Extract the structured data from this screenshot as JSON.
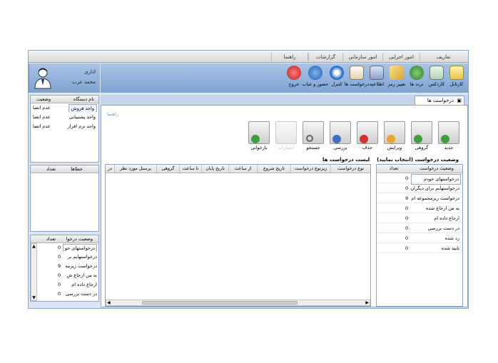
{
  "menu": [
    "تعاریف",
    "امور اجرایی",
    "امور سازمانی",
    "گزارشات",
    "راهنما"
  ],
  "toolbar": [
    {
      "label": "کارتابل",
      "icon": "inbox-icon",
      "color": "#e9c54a"
    },
    {
      "label": "کاردکس",
      "icon": "cardex-icon",
      "color": "#3d8f3d"
    },
    {
      "label": "تردد ها",
      "icon": "traffic-icon",
      "color": "#2f7a2f"
    },
    {
      "label": "تغییر رمز",
      "icon": "key-icon",
      "color": "#d6a531"
    },
    {
      "label": "اطلاعیه",
      "icon": "notice-icon",
      "color": "#6a7fb5"
    },
    {
      "label": "درخواست ها",
      "icon": "request-icon",
      "color": "#c8a06a"
    },
    {
      "label": "کنترل",
      "icon": "control-icon",
      "color": "#2a6fc6"
    },
    {
      "label": "حضور و غیاب",
      "icon": "attendance-icon",
      "color": "#2a6fc6"
    },
    {
      "label": "خروج",
      "icon": "exit-icon",
      "color": "#d42b2b"
    }
  ],
  "user": {
    "role": "ادارى",
    "name": "محمد عرب"
  },
  "units": {
    "header": {
      "name": "نام دستگاه",
      "status": "وضعیت"
    },
    "rows": [
      {
        "name": "واحد فروش",
        "status": "عدم اتصا"
      },
      {
        "name": "واحد پشتیبانی",
        "status": "عدم اتصا"
      },
      {
        "name": "واحد نرم افزار",
        "status": "عدم اتصا"
      }
    ]
  },
  "errors": {
    "header": {
      "errors": "خطاها",
      "count": "تعداد"
    }
  },
  "req_status_small": {
    "header": {
      "status": "وضعیت درخوا",
      "count": "تعداد"
    },
    "rows": [
      {
        "label": "درخواستهای خو",
        "count": "0"
      },
      {
        "label": "درخواستهایم بر",
        "count": "0"
      },
      {
        "label": "درخواست زیرمه",
        "count": "9"
      },
      {
        "label": "به من ارجاع ش",
        "count": "0"
      },
      {
        "label": "ارجاع داده ام",
        "count": "0"
      },
      {
        "label": "در دست بررسی",
        "count": "0"
      }
    ]
  },
  "tab": {
    "label": "درخواست ها"
  },
  "crumb": "راهنما",
  "actions": [
    {
      "label": "جدید",
      "icon": "new-icon",
      "color": "#3f9f3f",
      "enabled": true
    },
    {
      "label": "گروهی",
      "icon": "group-icon",
      "color": "#3f9f3f",
      "enabled": true
    },
    {
      "label": "ویرایش",
      "icon": "edit-icon",
      "color": "#e9a52e",
      "enabled": true
    },
    {
      "label": "حذف",
      "icon": "delete-icon",
      "color": "#d43030",
      "enabled": true
    },
    {
      "label": "بررسی",
      "icon": "review-icon",
      "color": "#3b6fbf",
      "enabled": true
    },
    {
      "label": "جستجو",
      "icon": "search-icon",
      "color": "#999",
      "enabled": true
    },
    {
      "label": "اختیارات",
      "icon": "options-icon",
      "color": "#aaa",
      "enabled": false
    },
    {
      "label": "بازخوانی",
      "icon": "refresh-icon",
      "color": "#3f9f3f",
      "enabled": true
    }
  ],
  "status_panel": {
    "title": "وضعیت درخواست (انتخاب نمایید)",
    "header": {
      "status": "وضعیت درخواست",
      "count": "تعداد"
    },
    "rows": [
      {
        "label": "درخواستهای خودم",
        "count": "0"
      },
      {
        "label": "درخواستهایم برای دیگران",
        "count": "0"
      },
      {
        "label": "درخواست زیرمجموعه ام",
        "count": "9"
      },
      {
        "label": "به من ارجاع شده",
        "count": "0"
      },
      {
        "label": "ارجاع داده ام",
        "count": "0"
      },
      {
        "label": "در دست بررسی",
        "count": "0"
      },
      {
        "label": "رد شده",
        "count": "0"
      },
      {
        "label": "تایید شده",
        "count": "0"
      }
    ]
  },
  "list": {
    "title": "لیست درخواست ها",
    "columns": [
      "نوع درخواست",
      "زیرنوع درخواست",
      "تاریخ شروع",
      "از ساعت",
      "تاریخ پایان",
      "تا ساعت",
      "گروهی",
      "پرسنل مورد نظر",
      "در"
    ]
  }
}
